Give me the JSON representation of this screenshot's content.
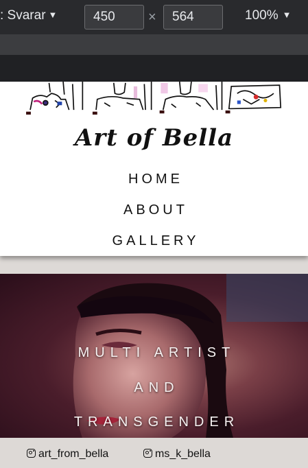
{
  "devtools": {
    "device_label": ": Svarar",
    "width_value": "450",
    "height_value": "564",
    "times_symbol": "×",
    "zoom_label": "100%"
  },
  "site": {
    "logo_text": "Art of Bella",
    "nav": [
      "HOME",
      "ABOUT",
      "GALLERY"
    ],
    "hero": {
      "lines": [
        "MULTI ARTIST",
        "AND",
        "TRANSGENDER"
      ]
    },
    "social": [
      {
        "icon": "instagram-icon",
        "handle": "art_from_bella"
      },
      {
        "icon": "instagram-icon",
        "handle": "ms_k_bella"
      }
    ]
  },
  "colors": {
    "devtools_bg": "#292a2d",
    "header_bg": "#ffffff",
    "hero_tint": "#4a1d2b",
    "footer_bg": "#ddd9d6"
  }
}
